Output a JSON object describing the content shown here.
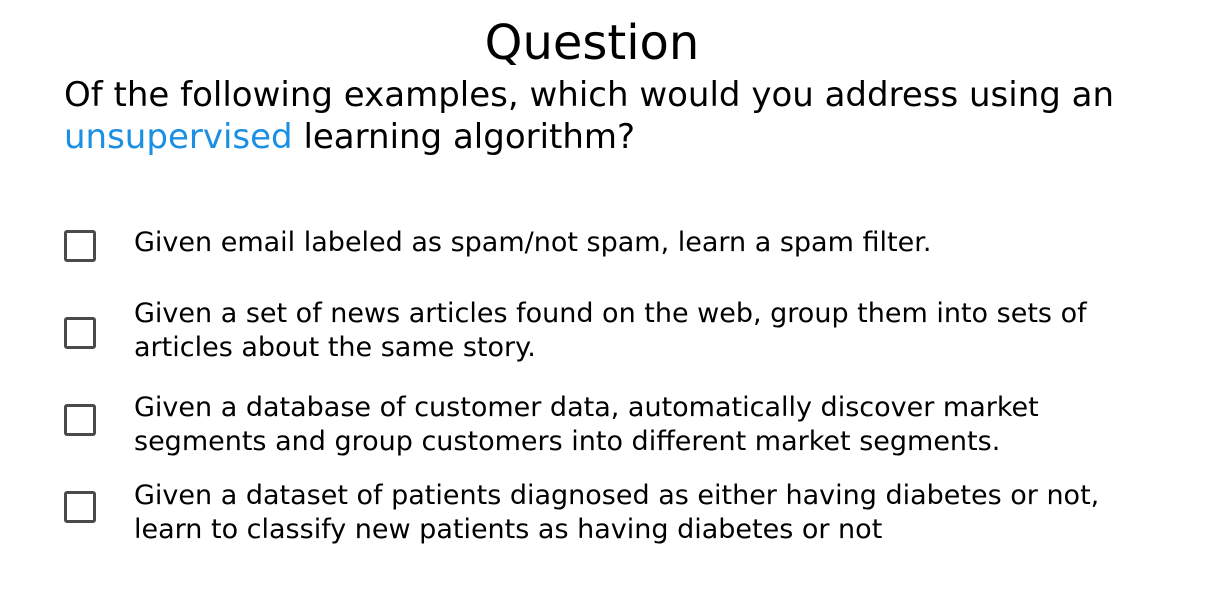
{
  "title": "Question",
  "prompt": {
    "before": "Of the following examples, which would you address using an",
    "highlight": "unsupervised",
    "after": "learning algorithm?"
  },
  "options": [
    {
      "text": "Given email labeled as spam/not spam, learn a spam filter.",
      "checked": false
    },
    {
      "text": "Given a set of news articles found on the web, group them into sets of articles about the same story.",
      "checked": false
    },
    {
      "text": "Given a database of customer data, automatically discover market segments and group customers into different market segments.",
      "checked": false
    },
    {
      "text": "Given a dataset of patients diagnosed as either having diabetes or not, learn to classify new patients as having diabetes or not",
      "checked": false
    }
  ],
  "colors": {
    "highlight": "#1a8fe3",
    "checkbox_border": "#4a4a4a"
  }
}
